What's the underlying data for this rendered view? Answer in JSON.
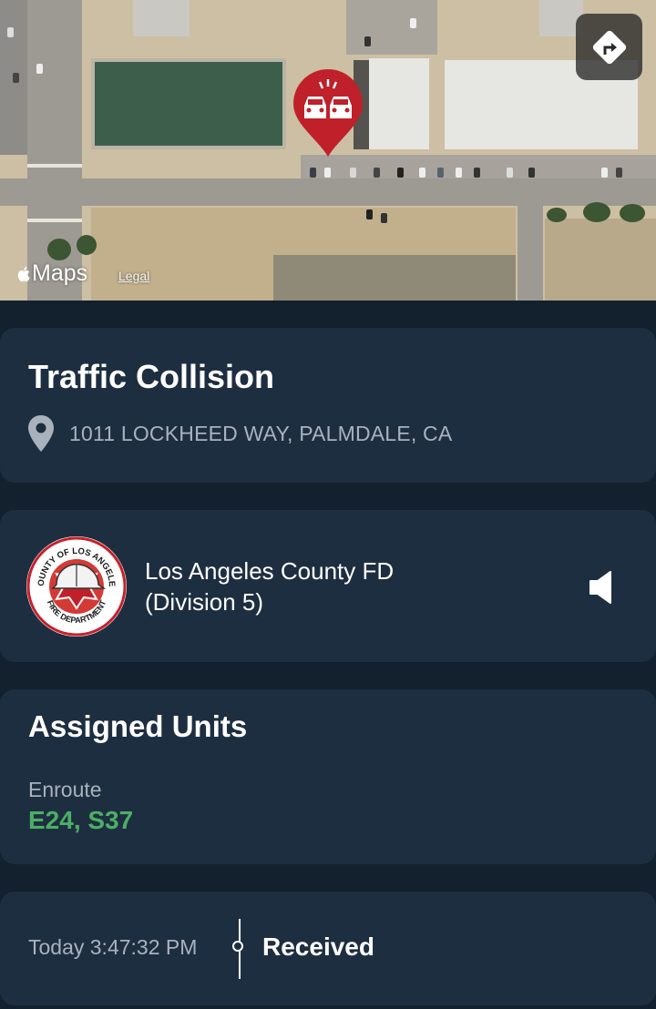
{
  "map": {
    "logo_text": "Maps",
    "legal_link": "Legal",
    "marker_icon": "car-collision-icon",
    "marker_color": "#c0202a",
    "directions_icon": "directions-arrow-icon"
  },
  "incident": {
    "title": "Traffic Collision",
    "address": "1011 LOCKHEED WAY, PALMDALE, CA",
    "address_icon": "location-pin-icon"
  },
  "agency": {
    "name_line1": "Los Angeles County FD",
    "name_line2": "(Division 5)",
    "seal_text_top": "COUNTY OF LOS ANGELES",
    "seal_text_bottom": "FIRE DEPARTMENT",
    "audio_icon": "speaker-icon"
  },
  "units": {
    "title": "Assigned Units",
    "status": "Enroute",
    "list": "E24, S37",
    "list_color": "#4caf64"
  },
  "timeline": {
    "time": "Today 3:47:32 PM",
    "event": "Received"
  }
}
